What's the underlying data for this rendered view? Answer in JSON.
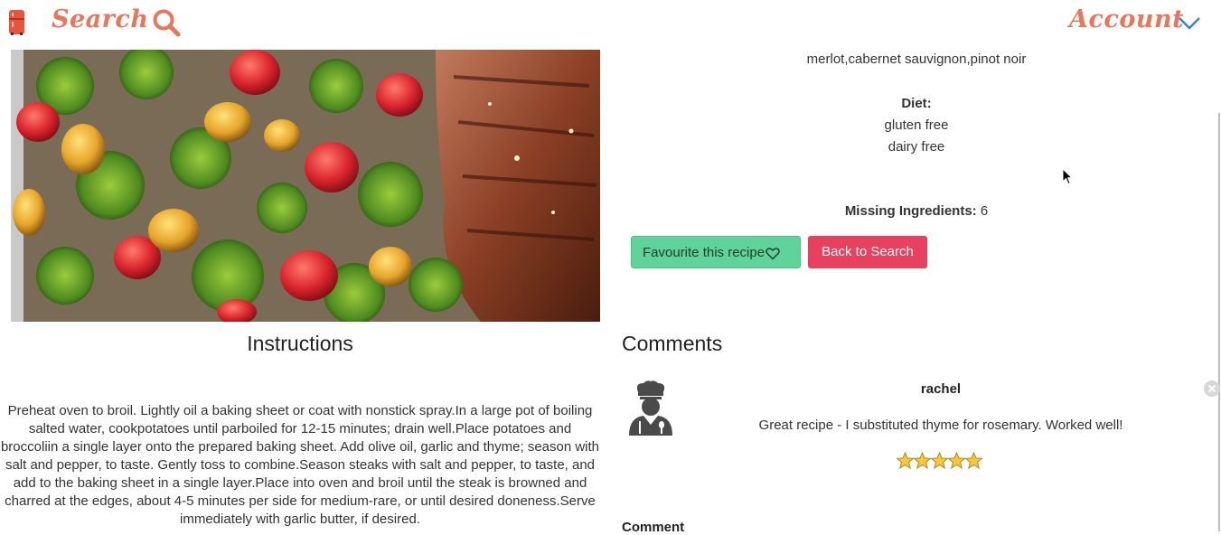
{
  "nav": {
    "search_label": "Search",
    "account_label": "Account"
  },
  "recipe": {
    "wine_pairing": "merlot,cabernet sauvignon,pinot noir",
    "diet_label": "Diet:",
    "diets": [
      "gluten free",
      "dairy free"
    ],
    "missing_label": "Missing Ingredients:",
    "missing_count": "6"
  },
  "buttons": {
    "favourite_label": "Favourite this recipe",
    "back_label": "Back to Search"
  },
  "instructions": {
    "title": "Instructions",
    "text": "Preheat oven to broil. Lightly oil a baking sheet or coat with nonstick spray.In a large pot of boiling salted water, cookpotatoes until parboiled for 12-15 minutes; drain well.Place potatoes and broccoliin a single layer onto the prepared baking sheet. Add olive oil, garlic and thyme; season with salt and pepper, to taste. Gently toss to combine.Season steaks with salt and pepper, to taste, and add to the baking sheet in a single layer.Place into oven and broil until the steak is browned and charred at the edges, about 4-5 minutes per side for medium-rare, or until desired doneness.Serve immediately with garlic butter, if desired."
  },
  "comments": {
    "title": "Comments",
    "items": [
      {
        "user": "rachel",
        "text": "Great recipe - I substituted thyme for rosemary. Worked well!",
        "rating": 5
      }
    ],
    "form_label": "Comment"
  },
  "colors": {
    "brand": "#e8765a",
    "favourite": "#5fd39a",
    "back": "#e8415f",
    "chevron": "#3b7fd9"
  }
}
